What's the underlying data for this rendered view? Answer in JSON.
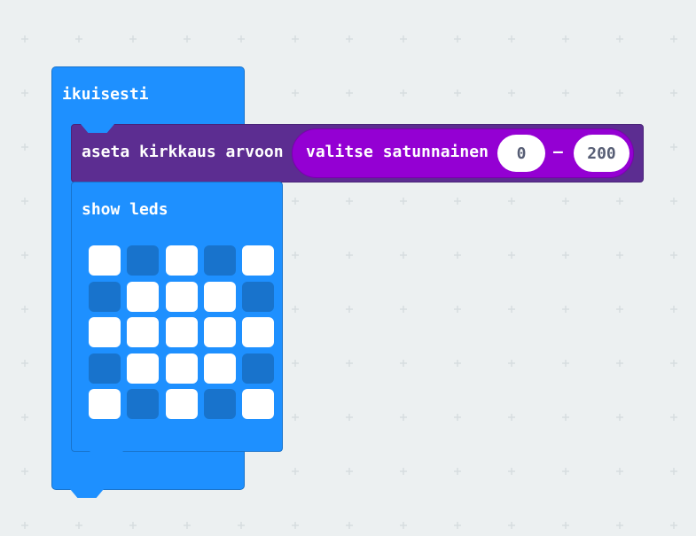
{
  "colors": {
    "background": "#ecf0f1",
    "grid_mark": "#d6dde0",
    "basic_blue": "#1e90ff",
    "led_purple": "#5c2d91",
    "math_violet": "#9400d3",
    "led_on": "#ffffff",
    "led_off": "#1873cc"
  },
  "forever_block": {
    "label": "ikuisesti"
  },
  "brightness_block": {
    "label": "aseta kirkkaus arvoon",
    "random": {
      "label": "valitse satunnainen",
      "min": "0",
      "separator": "–",
      "max": "200"
    }
  },
  "show_leds_block": {
    "label": "show leds",
    "leds": [
      [
        1,
        0,
        1,
        0,
        1
      ],
      [
        0,
        1,
        1,
        1,
        0
      ],
      [
        1,
        1,
        1,
        1,
        1
      ],
      [
        0,
        1,
        1,
        1,
        0
      ],
      [
        1,
        0,
        1,
        0,
        1
      ]
    ]
  }
}
